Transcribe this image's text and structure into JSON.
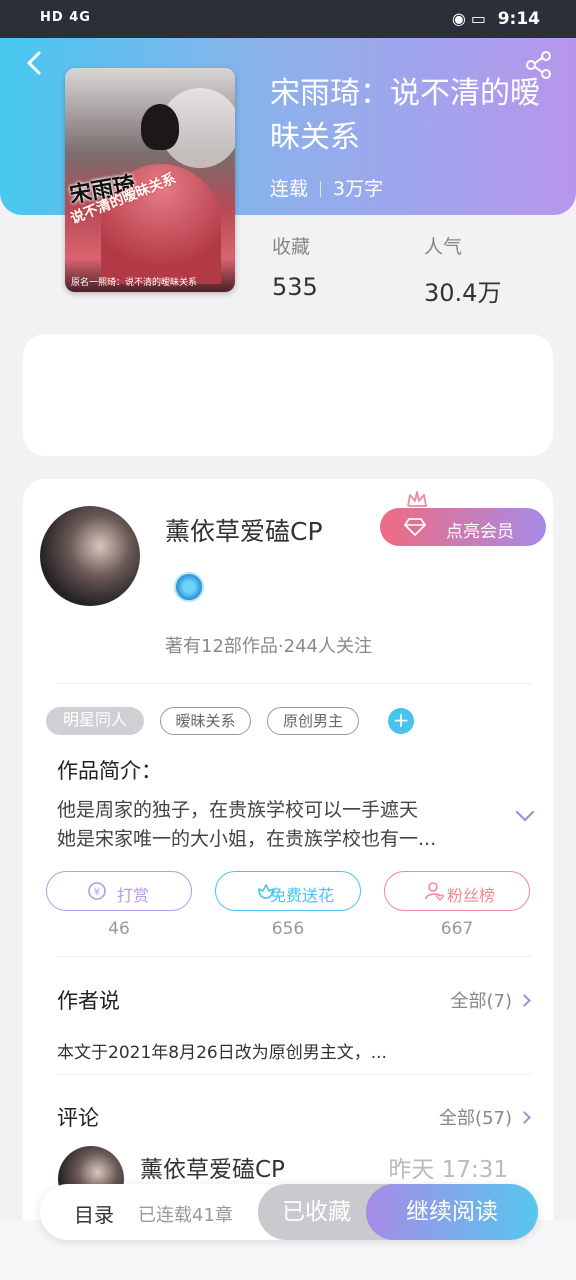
{
  "status_bar": {
    "left": "HD 4G",
    "time": "9:14"
  },
  "book": {
    "title": "宋雨琦：说不清的暧昧关系",
    "status": "连载",
    "words": "3万字",
    "cover_title": "宋雨琦",
    "cover_subtitle": "说不清的暧昧关系",
    "cover_caption": "原名一熙琦：说不清的暧昧关系",
    "stats": [
      {
        "label": "收藏",
        "value": "535"
      },
      {
        "label": "人气",
        "value": "30.4万"
      }
    ]
  },
  "author": {
    "name": "薰依草爱磕CP",
    "vip_label": "点亮会员",
    "works": "著有12部作品·244人关注"
  },
  "tags": [
    {
      "label": "明星同人"
    },
    {
      "label": "暧昧关系"
    },
    {
      "label": "原创男主"
    }
  ],
  "intro": {
    "title": "作品简介：",
    "line1": "他是周家的独子，在贵族学校可以一手遮天",
    "line2": "她是宋家唯一的大小姐，在贵族学校也有一..."
  },
  "actions": [
    {
      "label": "打赏",
      "count": "46",
      "color": "#b79be6"
    },
    {
      "label": "免费送花",
      "count": "656",
      "color": "#46c4ee"
    },
    {
      "label": "粉丝榜",
      "count": "667",
      "color": "#ef8a96"
    }
  ],
  "author_says": {
    "title": "作者说",
    "more": "全部(7)",
    "text": "本文于2021年8月26日改为原创男主文，..."
  },
  "comments": {
    "title": "评论",
    "more": "全部(57)",
    "first": {
      "name": "薰依草爱磕CP",
      "time": "昨天 17:31"
    }
  },
  "bottom": {
    "toc": "目录",
    "chapters": "已连载41章",
    "saved": "已收藏",
    "read": "继续阅读"
  }
}
